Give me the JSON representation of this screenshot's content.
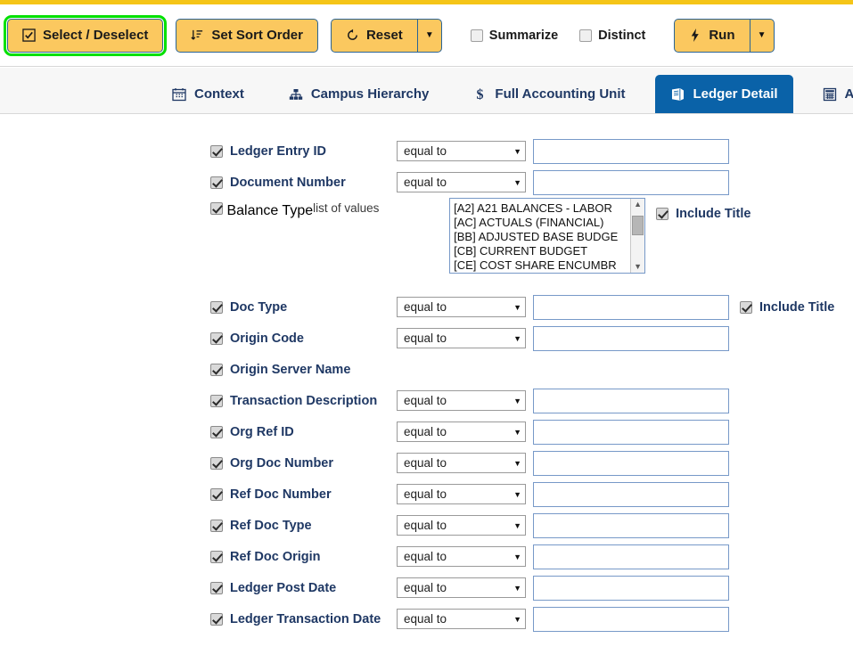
{
  "toolbar": {
    "buttons": [
      {
        "label": "Select / Deselect",
        "icon": "checkbox-square-icon",
        "highlighted": true
      },
      {
        "label": "Set Sort Order",
        "icon": "sort-descending-icon",
        "highlighted": false
      },
      {
        "label": "Reset",
        "icon": "reset-circular-arrow-icon",
        "highlighted": false
      }
    ],
    "reset_caret": "▼",
    "checkboxes": [
      {
        "label": "Summarize",
        "checked": false
      },
      {
        "label": "Distinct",
        "checked": false
      }
    ],
    "run": {
      "label": "Run",
      "icon": "lightning-bolt-icon",
      "caret": "▼"
    }
  },
  "tabs": [
    {
      "label": "Context",
      "icon": "calendar-icon",
      "active": false
    },
    {
      "label": "Campus Hierarchy",
      "icon": "org-chart-icon",
      "active": false
    },
    {
      "label": "Full Accounting Unit",
      "icon": "dollar-sign-icon",
      "active": false
    },
    {
      "label": "Ledger Detail",
      "icon": "book-icon",
      "active": true
    },
    {
      "label": "Am",
      "icon": "calculator-icon",
      "active": false
    }
  ],
  "operator_default": "equal to",
  "operator_caret": "▼",
  "lov_label": "list of values",
  "include_title_label": "Include Title",
  "balance_type_options": [
    "[A2] A21 BALANCES - LABOR",
    "[AC] ACTUALS (FINANCIAL)",
    "[BB] ADJUSTED BASE BUDGE",
    "[CB] CURRENT BUDGET",
    "[CE] COST SHARE ENCUMBR"
  ],
  "fields": [
    {
      "label": "Ledger Entry ID",
      "checked": true,
      "control": "operator",
      "value": "",
      "include_title": false
    },
    {
      "label": "Document Number",
      "checked": true,
      "control": "operator",
      "value": "",
      "include_title": false
    },
    {
      "label": "Balance Type",
      "checked": true,
      "control": "listbox",
      "value": "",
      "include_title": true
    },
    {
      "label": "Doc Type",
      "checked": true,
      "control": "operator",
      "value": "",
      "include_title": true
    },
    {
      "label": "Origin Code",
      "checked": true,
      "control": "operator",
      "value": "",
      "include_title": false
    },
    {
      "label": "Origin Server Name",
      "checked": true,
      "control": "none",
      "value": "",
      "include_title": false
    },
    {
      "label": "Transaction Description",
      "checked": true,
      "control": "operator",
      "value": "",
      "include_title": false
    },
    {
      "label": "Org Ref ID",
      "checked": true,
      "control": "operator",
      "value": "",
      "include_title": false
    },
    {
      "label": "Org Doc Number",
      "checked": true,
      "control": "operator",
      "value": "",
      "include_title": false
    },
    {
      "label": "Ref Doc Number",
      "checked": true,
      "control": "operator",
      "value": "",
      "include_title": false
    },
    {
      "label": "Ref Doc Type",
      "checked": true,
      "control": "operator",
      "value": "",
      "include_title": false
    },
    {
      "label": "Ref Doc Origin",
      "checked": true,
      "control": "operator",
      "value": "",
      "include_title": false
    },
    {
      "label": "Ledger Post Date",
      "checked": true,
      "control": "operator",
      "value": "",
      "include_title": false
    },
    {
      "label": "Ledger Transaction Date",
      "checked": true,
      "control": "operator",
      "value": "",
      "include_title": false
    }
  ],
  "colors": {
    "accent_yellow": "#f5c518",
    "button_yellow": "#fbc85f",
    "active_tab_blue": "#0a62a8",
    "label_blue": "#1f3864",
    "highlight_green": "#00e000"
  }
}
